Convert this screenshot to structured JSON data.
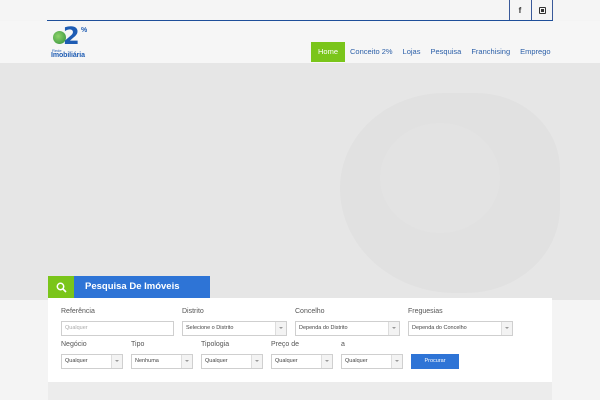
{
  "colors": {
    "accent_green": "#7ac51a",
    "accent_blue": "#2e74d6",
    "nav_text": "#2b5fa8"
  },
  "topbar": {
    "social": [
      {
        "name": "facebook-icon",
        "glyph": "f"
      },
      {
        "name": "youtube-icon",
        "glyph": ""
      }
    ]
  },
  "logo": {
    "number": "2",
    "percent": "%",
    "small": "Rede",
    "text": "Imobiliária"
  },
  "nav": {
    "items": [
      {
        "label": "Home",
        "active": true
      },
      {
        "label": "Conceito 2%",
        "active": false
      },
      {
        "label": "Lojas",
        "active": false
      },
      {
        "label": "Pesquisa",
        "active": false
      },
      {
        "label": "Franchising",
        "active": false
      },
      {
        "label": "Emprego",
        "active": false
      }
    ]
  },
  "search": {
    "title": "Pesquisa De Imóveis",
    "labels": {
      "referencia": "Referência",
      "distrito": "Distrito",
      "concelho": "Concelho",
      "freguesias": "Freguesias",
      "negocio": "Negócio",
      "tipo": "Tipo",
      "tipologia": "Tipologia",
      "preco_de": "Preço de",
      "preco_a": "a"
    },
    "fields": {
      "referencia_placeholder": "Qualquer",
      "distrito": "Selecione o Distrito",
      "concelho": "Dependa do Distrito",
      "freguesias": "Dependa do Concelho",
      "negocio": "Qualquer",
      "tipo": "Nenhuma",
      "tipologia": "Qualquer",
      "preco_de": "Qualquer",
      "preco_a": "Qualquer"
    },
    "button": "Procurar"
  }
}
